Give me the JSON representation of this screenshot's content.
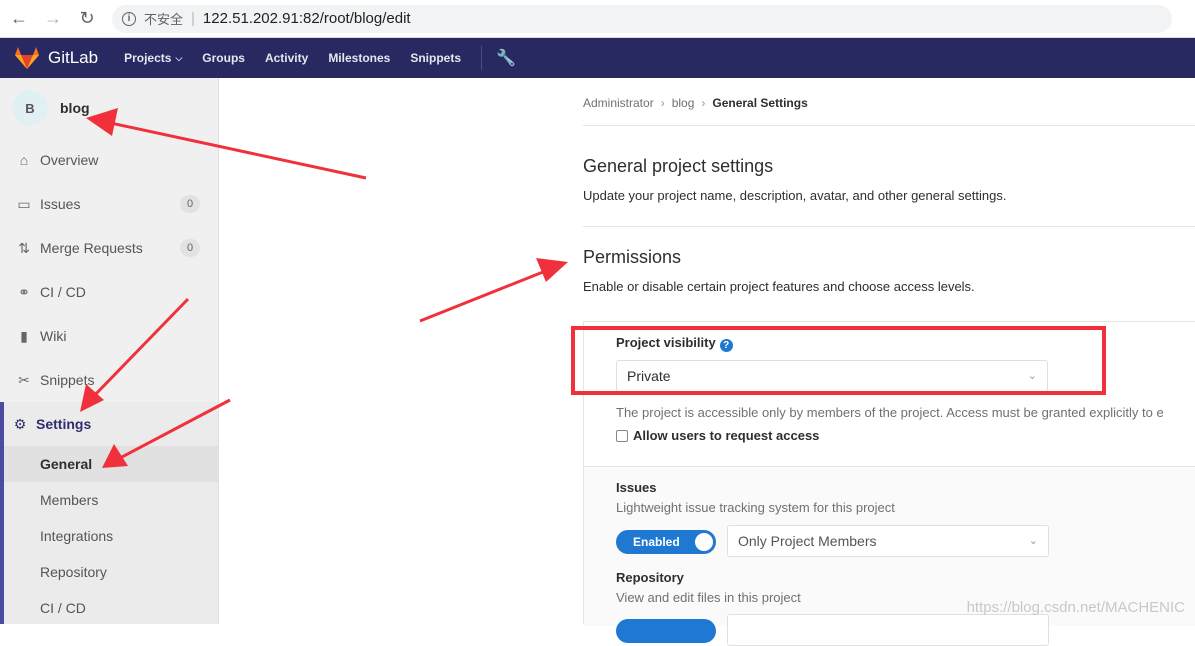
{
  "browser": {
    "url": "122.51.202.91:82/root/blog/edit",
    "insecure_label": "不安全"
  },
  "header": {
    "brand": "GitLab",
    "nav": [
      "Projects",
      "Groups",
      "Activity",
      "Milestones",
      "Snippets"
    ],
    "brand_color": "#292961"
  },
  "sidebar": {
    "project_avatar": "B",
    "project_name": "blog",
    "items": [
      {
        "label": "Overview",
        "icon": "home-icon"
      },
      {
        "label": "Issues",
        "icon": "issues-icon",
        "count": "0"
      },
      {
        "label": "Merge Requests",
        "icon": "merge-request-icon",
        "count": "0"
      },
      {
        "label": "CI / CD",
        "icon": "rocket-icon"
      },
      {
        "label": "Wiki",
        "icon": "book-icon"
      },
      {
        "label": "Snippets",
        "icon": "scissors-icon"
      },
      {
        "label": "Settings",
        "icon": "gear-icon"
      }
    ],
    "settings_sub": [
      "General",
      "Members",
      "Integrations",
      "Repository",
      "CI / CD"
    ]
  },
  "breadcrumb": [
    "Administrator",
    "blog",
    "General Settings"
  ],
  "general": {
    "title": "General project settings",
    "desc": "Update your project name, description, avatar, and other general settings."
  },
  "permissions": {
    "title": "Permissions",
    "desc": "Enable or disable certain project features and choose access levels.",
    "visibility_label": "Project visibility",
    "visibility_value": "Private",
    "visibility_help": "The project is accessible only by members of the project. Access must be granted explicitly to e",
    "request_access_label": "Allow users to request access",
    "issues_label": "Issues",
    "issues_desc": "Lightweight issue tracking system for this project",
    "toggle_label": "Enabled",
    "issues_access": "Only Project Members",
    "repo_label": "Repository",
    "repo_desc": "View and edit files in this project"
  },
  "watermark": "https://blog.csdn.net/MACHENIC",
  "annotation_color": "#f0313b"
}
